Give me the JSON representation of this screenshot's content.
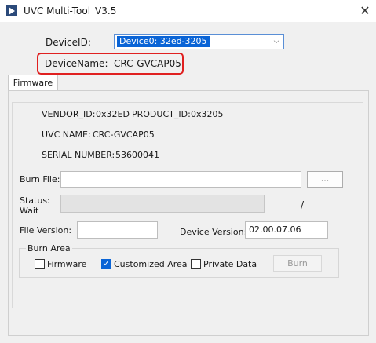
{
  "window": {
    "title": "UVC Multi-Tool_V3.5",
    "close_glyph": "✕"
  },
  "device": {
    "id_label": "DeviceID:",
    "id_value": "Device0: 32ed-3205",
    "name_label": "DeviceName:",
    "name_value": "CRC-GVCAP05",
    "highlight_color": "#e02020"
  },
  "tabs": [
    {
      "label": "Firmware",
      "active": true
    }
  ],
  "info": {
    "vendor_label": "VENDOR_ID:",
    "vendor_value": "0x32ED",
    "product_label": "PRODUCT_ID:",
    "product_value": "0x3205",
    "uvc_name_label": "UVC NAME:",
    "uvc_name_value": "CRC-GVCAP05",
    "serial_label": "SERIAL NUMBER:",
    "serial_value": "53600041"
  },
  "burn_file": {
    "label": "Burn File:",
    "value": "",
    "browse_label": "..."
  },
  "status": {
    "label": "Status:",
    "state": "Wait",
    "progress_text": "/"
  },
  "file_version": {
    "label": "File Version:",
    "value": ""
  },
  "device_version": {
    "label": "Device Version:",
    "value": "02.00.07.06"
  },
  "burn_area": {
    "title": "Burn Area",
    "options": [
      {
        "label": "Firmware",
        "checked": false
      },
      {
        "label": "Customized Area",
        "checked": true
      },
      {
        "label": "Private Data",
        "checked": false
      }
    ],
    "burn_label": "Burn",
    "burn_enabled": false
  },
  "colors": {
    "accent": "#0a64d6",
    "window_bg": "#f0f0f0"
  },
  "icons": {
    "app": "app-arrow-icon",
    "dropdown": "chevron-down-icon",
    "close": "close-icon",
    "check": "check-icon"
  }
}
